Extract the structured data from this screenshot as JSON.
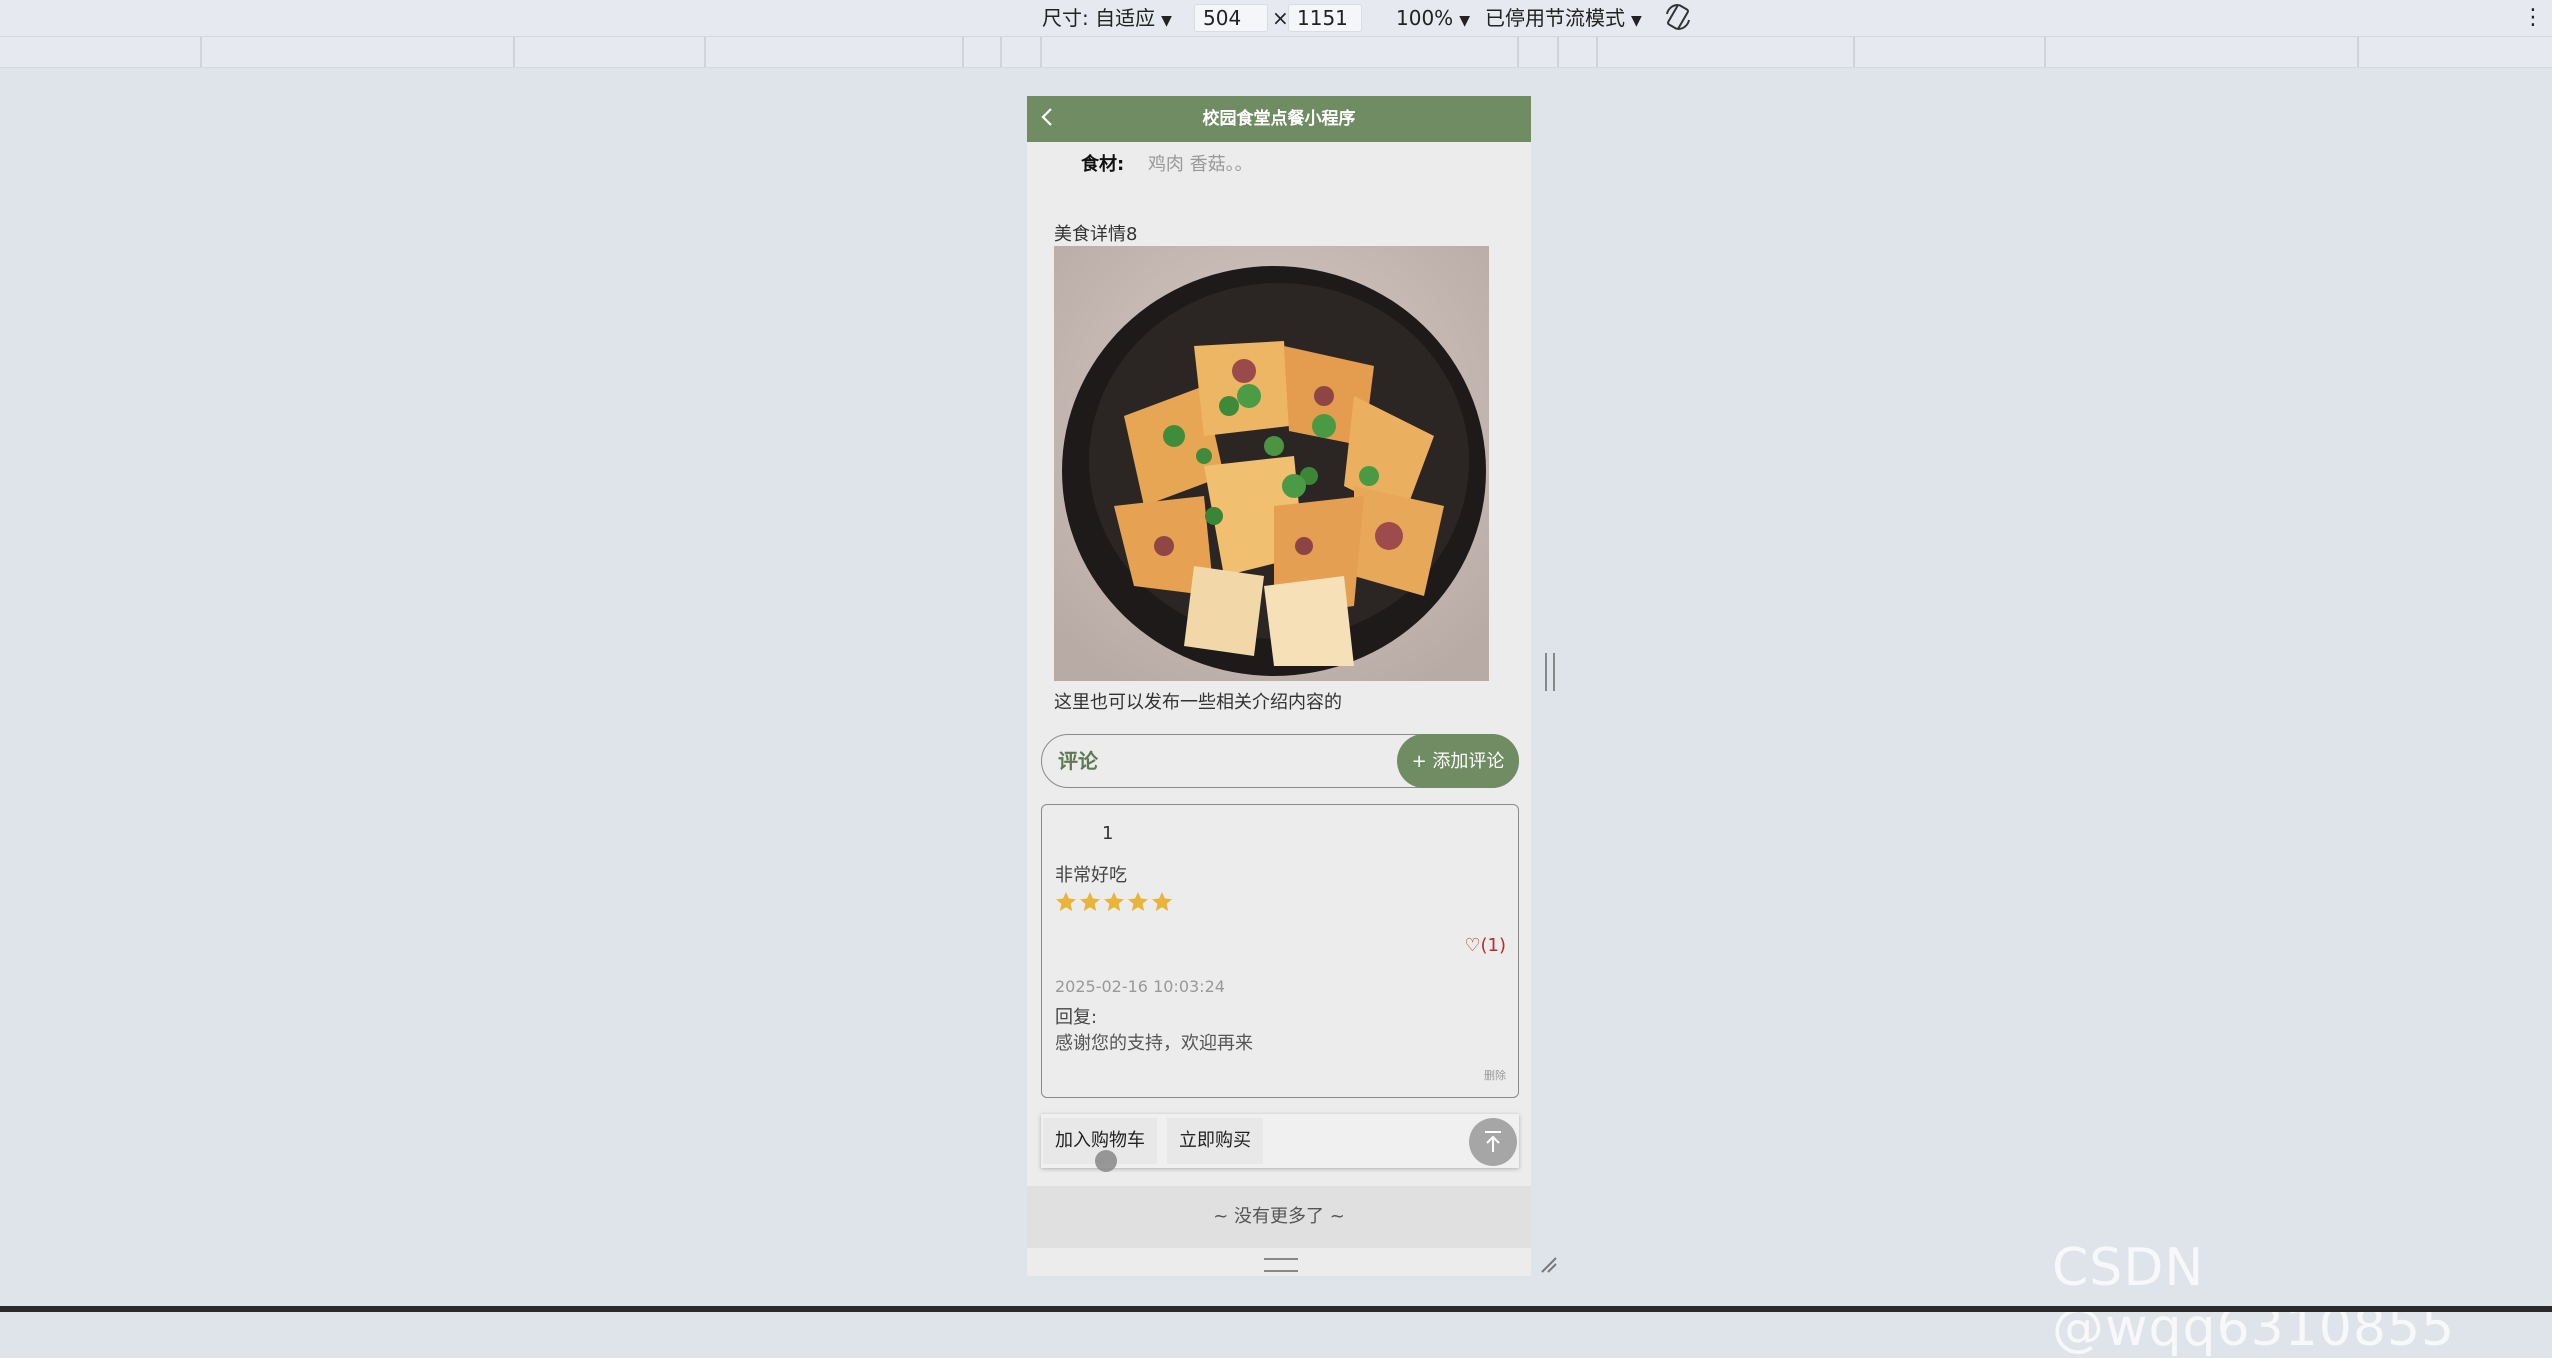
{
  "devtools": {
    "size_label": "尺寸: 自适应",
    "width": "504",
    "times": "×",
    "height": "1151",
    "zoom": "100%",
    "throttle": "已停用节流模式"
  },
  "app": {
    "nav_title": "校园食堂点餐小程序",
    "ingredients_label": "食材:",
    "ingredients_value": "鸡肉 香菇。。",
    "detail_title": "美食详情8",
    "intro": "这里也可以发布一些相关介绍内容的",
    "comment_label": "评论",
    "add_comment": "+ 添加评论",
    "comment": {
      "user": "1",
      "text": "非常好吃",
      "rating": 5,
      "likes": "(1)",
      "time": "2025-02-16 10:03:24",
      "reply_label": "回复:",
      "reply_text": "感谢您的支持，欢迎再来",
      "delete": "删除"
    },
    "add_to_cart": "加入购物车",
    "buy_now": "立即购买",
    "no_more": "~ 没有更多了 ~"
  },
  "colors": {
    "accent": "#6f8c62",
    "star": "#e9b43a",
    "like": "#b23030"
  },
  "watermark": "CSDN @wqq6310855"
}
